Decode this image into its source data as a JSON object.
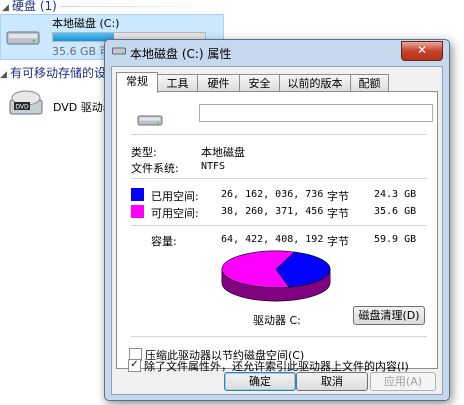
{
  "explorer": {
    "hard_disk_header": "硬盘 (1)",
    "drive_name": "本地磁盘 (C:)",
    "drive_free_text": "35.6 GB 可",
    "drive_used_fraction": 0.4,
    "removable_header": "有可移动存储的设",
    "dvd_name": "DVD 驱动器",
    "dvd_icon_text": "DVD"
  },
  "dialog": {
    "title": "本地磁盘 (C:) 属性",
    "close_glyph": "✕",
    "tabs": [
      "常规",
      "工具",
      "硬件",
      "安全",
      "以前的版本",
      "配额"
    ],
    "active_tab": 0,
    "name_value": "",
    "type_label": "类型:",
    "type_value": "本地磁盘",
    "fs_label": "文件系统:",
    "fs_value": "NTFS",
    "used": {
      "label": "已用空间:",
      "bytes": "26, 162, 036, 736",
      "unit": "字节",
      "size": "24.3 GB",
      "color": "#0000ff"
    },
    "free": {
      "label": "可用空间:",
      "bytes": "38, 260, 371, 456",
      "unit": "字节",
      "size": "35.6 GB",
      "color": "#ff00ff"
    },
    "capacity": {
      "label": "容量:",
      "bytes": "64, 422, 408, 192",
      "unit": "字节",
      "size": "59.9 GB"
    },
    "used_fraction": 0.406,
    "drive_label": "驱动器 C:",
    "cleanup_button": "磁盘清理(D)",
    "compress_label": "压缩此驱动器以节约磁盘空间(C)",
    "compress_checked": false,
    "index_label": "除了文件属性外，还允许索引此驱动器上文件的内容(I)",
    "index_checked": true,
    "ok_button": "确定",
    "cancel_button": "取消",
    "apply_button": "应用(A)"
  }
}
